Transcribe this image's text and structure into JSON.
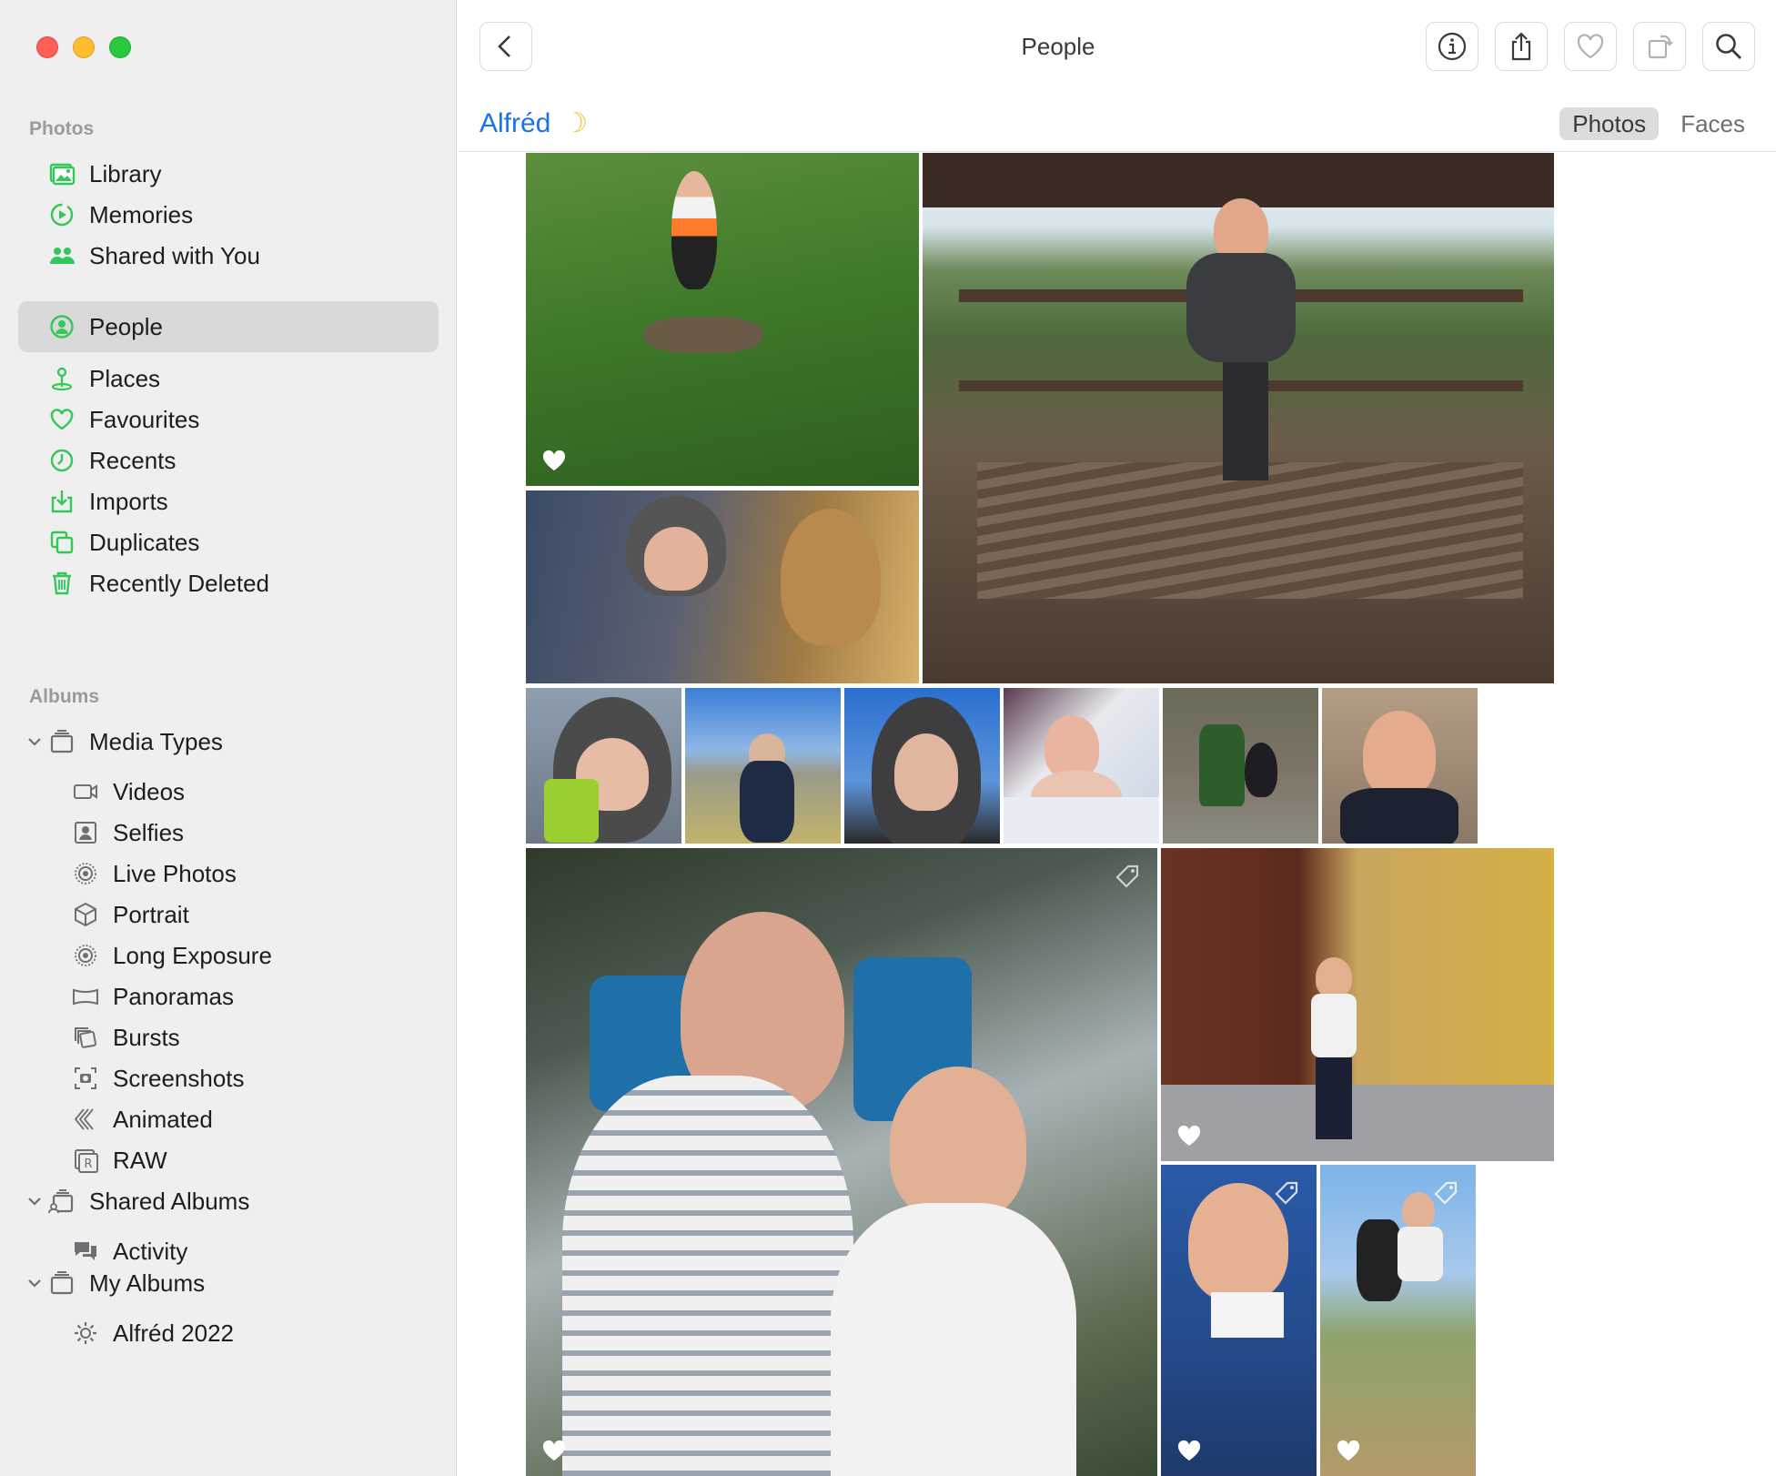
{
  "sidebar": {
    "photos_label": "Photos",
    "albums_label": "Albums",
    "items": [
      {
        "label": "Library",
        "icon": "library-icon"
      },
      {
        "label": "Memories",
        "icon": "memories-icon"
      },
      {
        "label": "Shared with You",
        "icon": "shared-with-you-icon"
      },
      {
        "label": "People",
        "icon": "people-icon",
        "selected": true
      },
      {
        "label": "Places",
        "icon": "places-icon"
      },
      {
        "label": "Favourites",
        "icon": "heart-icon"
      },
      {
        "label": "Recents",
        "icon": "clock-icon"
      },
      {
        "label": "Imports",
        "icon": "import-icon"
      },
      {
        "label": "Duplicates",
        "icon": "duplicates-icon"
      },
      {
        "label": "Recently Deleted",
        "icon": "trash-icon"
      }
    ],
    "albums": {
      "media_types": "Media Types",
      "media": [
        {
          "label": "Videos",
          "icon": "video-icon"
        },
        {
          "label": "Selfies",
          "icon": "selfie-icon"
        },
        {
          "label": "Live Photos",
          "icon": "live-photo-icon"
        },
        {
          "label": "Portrait",
          "icon": "portrait-icon"
        },
        {
          "label": "Long Exposure",
          "icon": "long-exposure-icon"
        },
        {
          "label": "Panoramas",
          "icon": "panorama-icon"
        },
        {
          "label": "Bursts",
          "icon": "bursts-icon"
        },
        {
          "label": "Screenshots",
          "icon": "screenshot-icon"
        },
        {
          "label": "Animated",
          "icon": "animated-icon"
        },
        {
          "label": "RAW",
          "icon": "raw-icon"
        }
      ],
      "shared_albums": "Shared Albums",
      "activity": "Activity",
      "my_albums": "My Albums",
      "album_2022": "Alfréd 2022"
    }
  },
  "toolbar": {
    "title": "People"
  },
  "person": {
    "name": "Alfréd",
    "tabs": [
      "Photos",
      "Faces"
    ],
    "active_tab": "Photos"
  },
  "colors": {
    "accent_green": "#34c759",
    "link_blue": "#1a73e8"
  }
}
